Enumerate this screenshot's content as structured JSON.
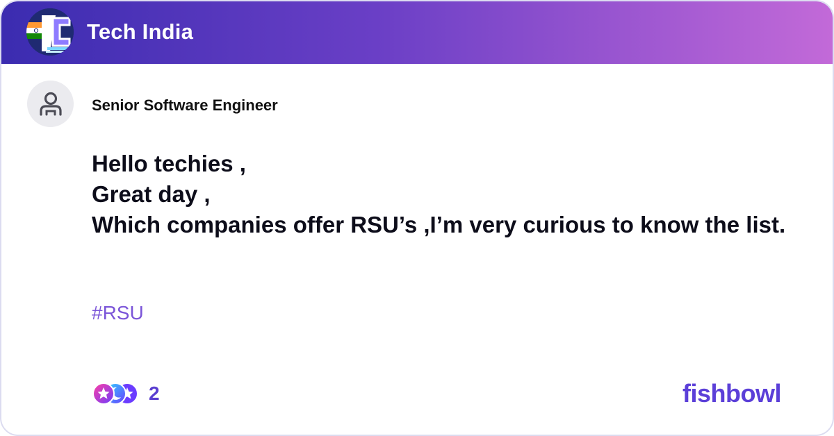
{
  "header": {
    "bowl_name": "Tech India",
    "gradient_start": "#3b2cb0",
    "gradient_end": "#c36ad8",
    "logo_icon": "tech-india-logo"
  },
  "author": {
    "avatar_icon": "user-icon",
    "title": "Senior Software Engineer"
  },
  "post": {
    "lines": [
      "Hello techies ,",
      "Great day ,",
      "Which companies offer RSU’s ,I’m very curious to know the list."
    ],
    "hashtag": "#RSU",
    "hashtag_color": "#7b55d8"
  },
  "reactions": {
    "icons": [
      "reaction-icon-star",
      "reaction-icon-moon",
      "reaction-icon-star"
    ],
    "count": "2"
  },
  "brand": {
    "name": "fishbowl",
    "color": "#5b3fd8"
  }
}
